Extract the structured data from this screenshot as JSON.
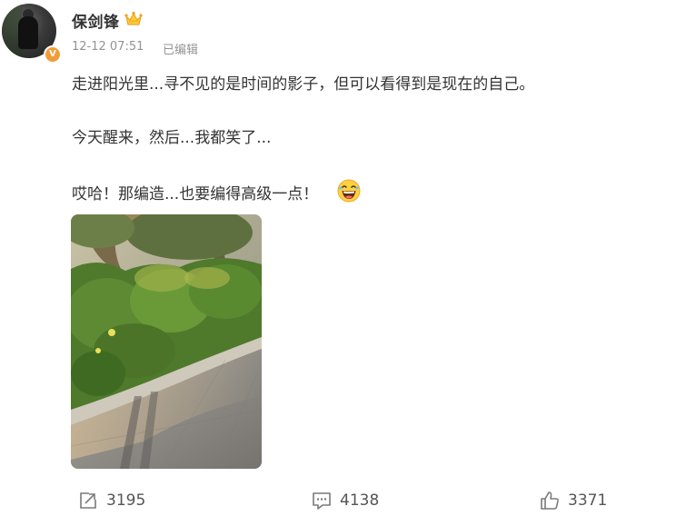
{
  "post": {
    "author": {
      "name": "保剑锋",
      "avatar_icon": "avatar-photo",
      "verified_icon": "verified-v-badge",
      "verified_mark": "V",
      "verified_color": "#f29c38",
      "vip_icon": "crown-icon"
    },
    "time": "12-12 07:51",
    "edited_label": "已编辑",
    "content_lines": [
      "走进阳光里...寻不见的是时间的影子，但可以看得到是现在的自己。",
      "今天醒来，然后...我都笑了...",
      "哎哈！那编造...也要编得高级一点！"
    ],
    "emoji": "laughing-emoji",
    "image_icon": "sunlit-hedge-photo",
    "actions": {
      "repost": {
        "icon": "repost-icon",
        "count": "3195"
      },
      "comment": {
        "icon": "comment-icon",
        "count": "4138"
      },
      "like": {
        "icon": "thumbs-up-icon",
        "count": "3371"
      }
    }
  }
}
